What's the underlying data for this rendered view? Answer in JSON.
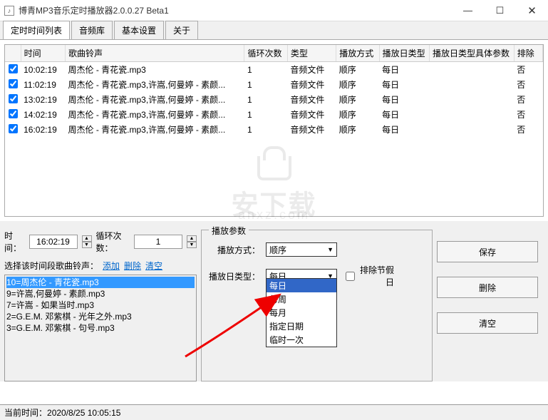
{
  "window": {
    "title": "博青MP3音乐定时播放器2.0.0.27 Beta1"
  },
  "tabs": [
    {
      "label": "定时时间列表"
    },
    {
      "label": "音频库"
    },
    {
      "label": "基本设置"
    },
    {
      "label": "关于"
    }
  ],
  "table": {
    "headers": {
      "chk": "",
      "time": "时间",
      "songs": "歌曲铃声",
      "loop": "循环次数",
      "type": "类型",
      "playmode": "播放方式",
      "daytype": "播放日类型",
      "dayparam": "播放日类型具体参数",
      "exclude": "排除"
    },
    "rows": [
      {
        "checked": true,
        "time": "10:02:19",
        "songs": "周杰伦 - 青花瓷.mp3",
        "loop": "1",
        "type": "音频文件",
        "playmode": "顺序",
        "daytype": "每日",
        "dayparam": "",
        "exclude": "否"
      },
      {
        "checked": true,
        "time": "11:02:19",
        "songs": "周杰伦 - 青花瓷.mp3,许嵩,何曼婷 - 素颜...",
        "loop": "1",
        "type": "音频文件",
        "playmode": "顺序",
        "daytype": "每日",
        "dayparam": "",
        "exclude": "否"
      },
      {
        "checked": true,
        "time": "13:02:19",
        "songs": "周杰伦 - 青花瓷.mp3,许嵩,何曼婷 - 素颜...",
        "loop": "1",
        "type": "音频文件",
        "playmode": "顺序",
        "daytype": "每日",
        "dayparam": "",
        "exclude": "否"
      },
      {
        "checked": true,
        "time": "14:02:19",
        "songs": "周杰伦 - 青花瓷.mp3,许嵩,何曼婷 - 素颜...",
        "loop": "1",
        "type": "音频文件",
        "playmode": "顺序",
        "daytype": "每日",
        "dayparam": "",
        "exclude": "否"
      },
      {
        "checked": true,
        "time": "16:02:19",
        "songs": "周杰伦 - 青花瓷.mp3,许嵩,何曼婷 - 素颜...",
        "loop": "1",
        "type": "音频文件",
        "playmode": "顺序",
        "daytype": "每日",
        "dayparam": "",
        "exclude": "否"
      }
    ]
  },
  "lower": {
    "time_label": "时间：",
    "time_value": "16:02:19",
    "loop_label": "循环次数：",
    "loop_value": "1",
    "song_select_label": "选择该时间段歌曲铃声：",
    "add": "添加",
    "remove": "删除",
    "clear": "清空",
    "songs": [
      "10=周杰伦 - 青花瓷.mp3",
      "9=许嵩,何曼婷 - 素颜.mp3",
      "7=许嵩 - 如果当时.mp3",
      "2=G.E.M. 邓紫棋 - 光年之外.mp3",
      "3=G.E.M. 邓紫棋 - 句号.mp3"
    ]
  },
  "params": {
    "group_title": "播放参数",
    "playmode_label": "播放方式：",
    "playmode_value": "顺序",
    "daytype_label": "播放日类型：",
    "daytype_value": "每日",
    "exclude_label": "排除节假日",
    "daytype_options": [
      "每日",
      "每周",
      "每月",
      "指定日期",
      "临时一次"
    ]
  },
  "actions": {
    "save": "保存",
    "delete": "删除",
    "clear": "清空"
  },
  "status": {
    "label": "当前时间：",
    "value": "2020/8/25 10:05:15"
  },
  "watermark": {
    "main": "安下载",
    "sub": "anxz.com"
  }
}
